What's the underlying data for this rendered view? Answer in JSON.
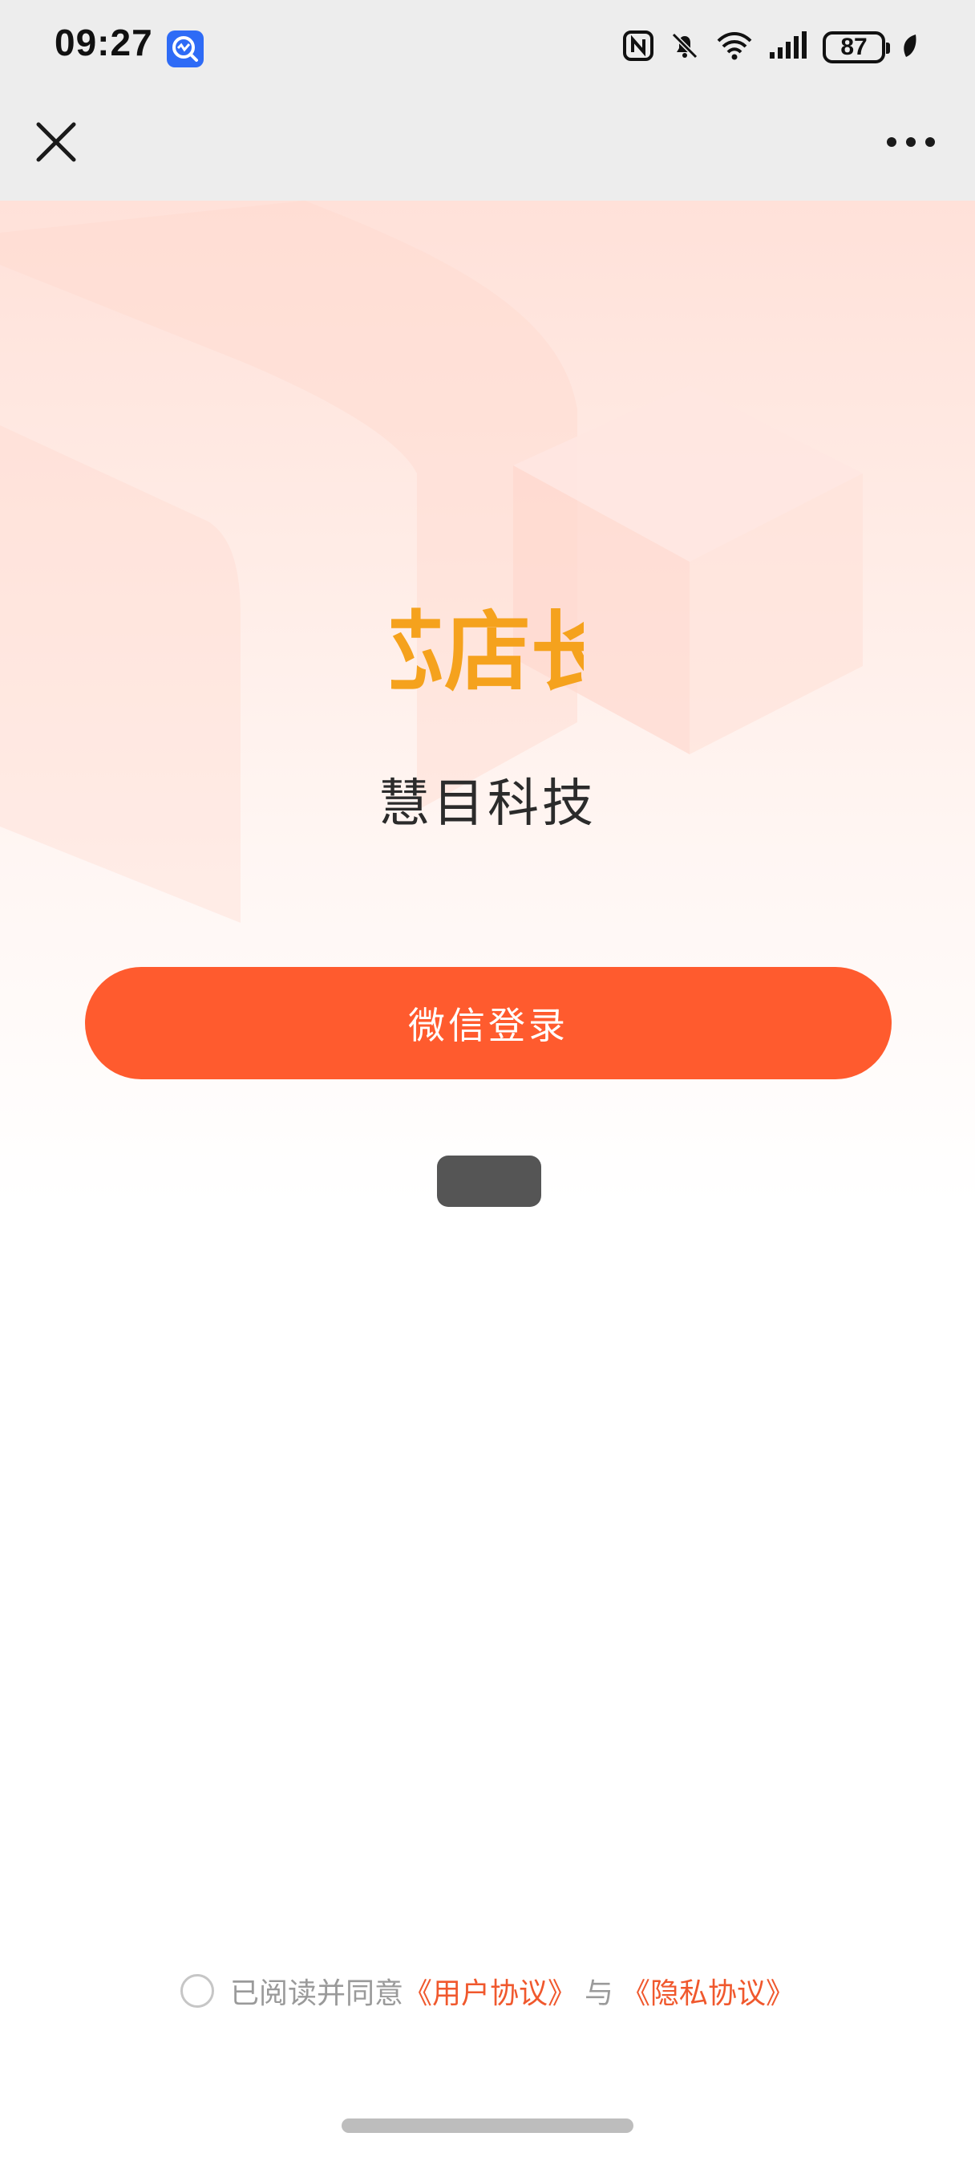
{
  "status_bar": {
    "time": "09:27",
    "battery_level": "87",
    "icons": [
      "nfc-icon",
      "mute-bell-icon",
      "wifi-icon",
      "signal-icon",
      "battery-icon",
      "leaf-icon"
    ]
  },
  "nav": {
    "close_icon": "close-icon",
    "more_icon": "more-icon"
  },
  "brand": {
    "logo_text": "芯店长",
    "company_name": "慧目科技",
    "logo_color": "#f5a21d"
  },
  "login": {
    "button_label": "微信登录",
    "button_color": "#ff5b2e"
  },
  "agreement": {
    "checked": false,
    "prefix": "已阅读并同意",
    "user_agreement": "《用户协议》",
    "connector": "与",
    "privacy_agreement": "《隐私协议》",
    "link_color": "#f0582d"
  }
}
